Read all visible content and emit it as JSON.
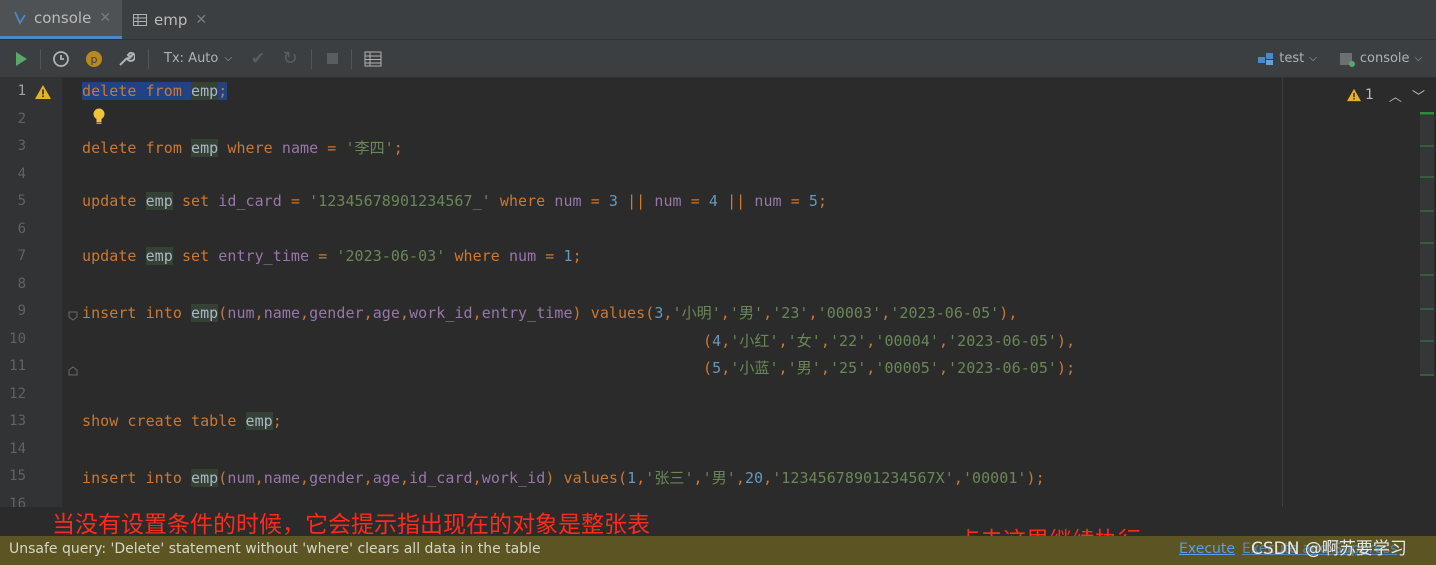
{
  "tabs": [
    {
      "label": "console",
      "icon": "console-icon",
      "active": true
    },
    {
      "label": "emp",
      "icon": "table-icon",
      "active": false
    }
  ],
  "toolbar": {
    "tx_mode": "Tx: Auto",
    "datasource": "test",
    "session": "console"
  },
  "inspection": {
    "warning_count": "1"
  },
  "editor": {
    "line_numbers": [
      "1",
      "2",
      "3",
      "4",
      "5",
      "6",
      "7",
      "8",
      "9",
      "10",
      "11",
      "12",
      "13",
      "14",
      "15",
      "16"
    ],
    "lines": {
      "l1": "delete from emp;",
      "l3": "delete from emp where name = '李四';",
      "l5": "update emp set id_card = '12345678901234567_' where num = 3 || num = 4 || num = 5;",
      "l7": "update emp set entry_time = '2023-06-03' where num = 1;",
      "l9": "insert into emp(num,name,gender,age,work_id,entry_time) values(3,'小明','男','23','00003','2023-06-05'),",
      "l10": "(4,'小红','女','22','00004','2023-06-05'),",
      "l11": "(5,'小蓝','男','25','00005','2023-06-05');",
      "l13": "show create table emp;",
      "l15": "insert into emp(num,name,gender,age,id_card,work_id) values(1,'张三','男',20,'12345678901234567X','00001');"
    }
  },
  "status": {
    "message": "Unsafe query: 'Delete' statement without 'where' clears all data in the table",
    "execute_label": "Execute",
    "execute_suppress_label": "Execute and Suppress"
  },
  "annotations": {
    "note_left": "当没有设置条件的时候，它会提示指出现在的对象是整张表",
    "note_right": "点击这里继续执行",
    "watermark": "CSDN @啊苏要学习"
  },
  "colors": {
    "keyword": "#cc7832",
    "string": "#6a8759",
    "number": "#6897bb",
    "column": "#9876aa",
    "annotation": "#ff2a1a",
    "status_bg": "#5c5423"
  }
}
